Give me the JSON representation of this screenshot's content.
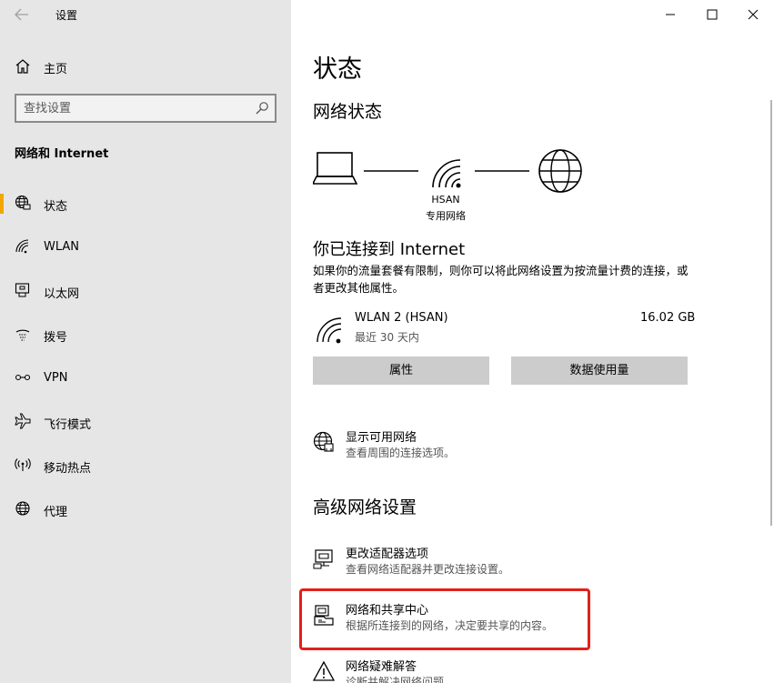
{
  "window": {
    "title": "设置",
    "back_icon": "back-arrow-icon",
    "controls": [
      "minimize-icon",
      "maximize-icon",
      "close-icon"
    ]
  },
  "sidebar": {
    "home_label": "主页",
    "search_placeholder": "查找设置",
    "section_title": "网络和 Internet",
    "accent_color": "#f0a800",
    "items": [
      {
        "label": "状态",
        "icon": "globe-status-icon",
        "active": true
      },
      {
        "label": "WLAN",
        "icon": "wifi-icon",
        "active": false
      },
      {
        "label": "以太网",
        "icon": "ethernet-icon",
        "active": false
      },
      {
        "label": "拨号",
        "icon": "dialup-icon",
        "active": false
      },
      {
        "label": "VPN",
        "icon": "vpn-icon",
        "active": false
      },
      {
        "label": "飞行模式",
        "icon": "airplane-icon",
        "active": false
      },
      {
        "label": "移动热点",
        "icon": "hotspot-icon",
        "active": false
      },
      {
        "label": "代理",
        "icon": "globe-icon",
        "active": false
      }
    ]
  },
  "main": {
    "page_title": "状态",
    "network_status_heading": "网络状态",
    "network": {
      "name": "HSAN",
      "type": "专用网络"
    },
    "connected_title": "你已连接到 Internet",
    "connected_desc": "如果你的流量套餐有限制，则你可以将此网络设置为按流量计费的连接，或者更改其他属性。",
    "adapter": {
      "name": "WLAN 2 (HSAN)",
      "period": "最近 30 天内",
      "usage": "16.02 GB"
    },
    "buttons": {
      "properties": "属性",
      "data_usage": "数据使用量"
    },
    "show_networks": {
      "title": "显示可用网络",
      "subtitle": "查看周围的连接选项。"
    },
    "advanced_heading": "高级网络设置",
    "advanced": [
      {
        "title": "更改适配器选项",
        "subtitle": "查看网络适配器并更改连接设置。",
        "icon": "adapter-icon"
      },
      {
        "title": "网络和共享中心",
        "subtitle": "根据所连接到的网络，决定要共享的内容。",
        "icon": "sharing-center-icon"
      },
      {
        "title": "网络疑难解答",
        "subtitle": "诊断并解决网络问题。",
        "icon": "warning-icon"
      }
    ],
    "highlight_color": "#e3201b"
  }
}
